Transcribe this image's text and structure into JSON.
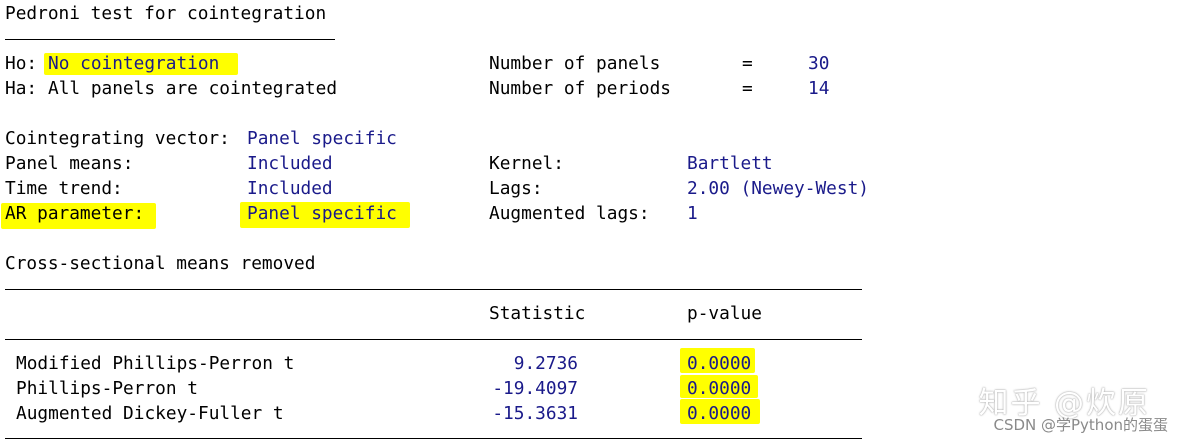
{
  "title": "Pedroni test for cointegration",
  "hypotheses": {
    "ho_label": "Ho:",
    "ho_value": "No cointegration",
    "ha_label": "Ha:",
    "ha_value": "All panels are cointegrated"
  },
  "panels": {
    "num_panels_label": "Number of panels",
    "num_panels_eq": "=",
    "num_panels_value": "30",
    "num_periods_label": "Number of periods",
    "num_periods_eq": "=",
    "num_periods_value": "14"
  },
  "settings": {
    "coint_vector_label": "Cointegrating vector:",
    "coint_vector_value": "Panel specific",
    "panel_means_label": "Panel means:",
    "panel_means_value": "Included",
    "time_trend_label": "Time trend:",
    "time_trend_value": "Included",
    "ar_param_label": "AR parameter:",
    "ar_param_value": "Panel specific",
    "kernel_label": "Kernel:",
    "kernel_value": "Bartlett",
    "lags_label": "Lags:",
    "lags_value": "2.00 (Newey-West)",
    "aug_lags_label": "Augmented lags:",
    "aug_lags_value": "1"
  },
  "cs_note": "Cross-sectional means removed",
  "table": {
    "col_statistic": "Statistic",
    "col_pvalue": "p-value",
    "rows": [
      {
        "name": "Modified Phillips-Perron t",
        "statistic": "9.2736",
        "pvalue": "0.0000"
      },
      {
        "name": "Phillips-Perron t",
        "statistic": "-19.4097",
        "pvalue": "0.0000"
      },
      {
        "name": "Augmented Dickey-Fuller t",
        "statistic": "-15.3631",
        "pvalue": "0.0000"
      }
    ]
  },
  "highlight_color": "#ffff00",
  "watermark": {
    "main": "知乎 @炊原",
    "sub": "CSDN @学Python的蛋蛋"
  }
}
